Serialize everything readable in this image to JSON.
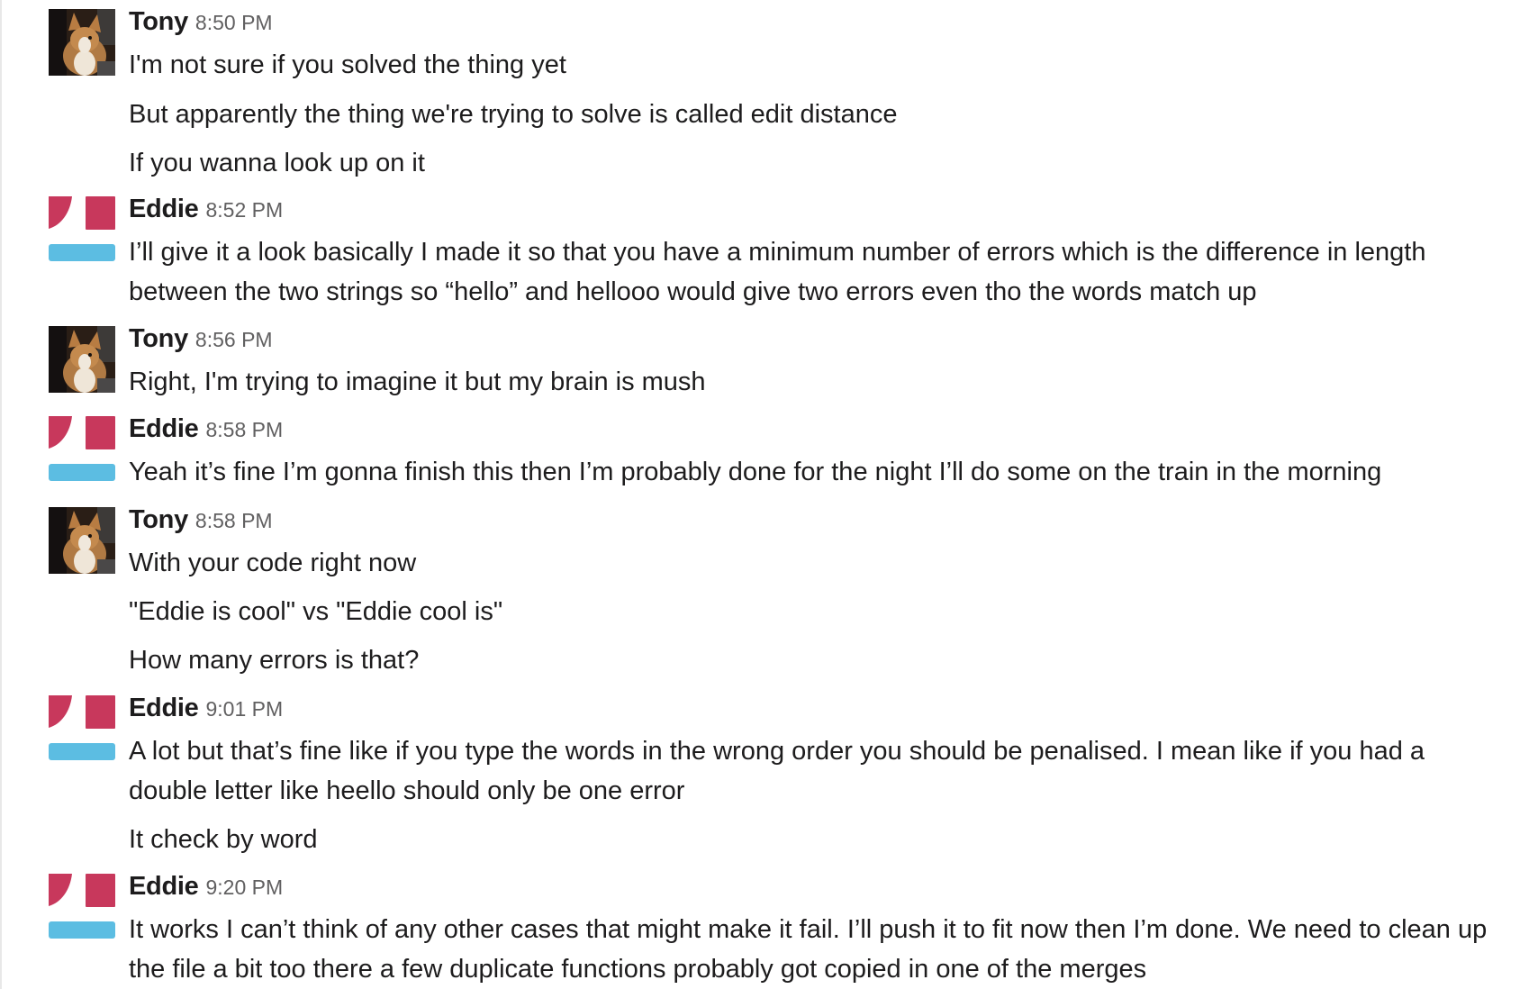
{
  "messages": [
    {
      "sender": "Tony",
      "time": "8:50 PM",
      "avatar_icon": "corgi-photo",
      "lines": [
        "I'm not sure if you solved the thing yet",
        "But apparently the thing we're trying to solve is called edit distance",
        "If you wanna look up on it"
      ]
    },
    {
      "sender": "Eddie",
      "time": "8:52 PM",
      "avatar_icon": "geometric-identicon",
      "lines": [
        "I’ll give it a look basically I made it so that you have a minimum number of errors which is the difference in length between the two strings so “hello” and hellooo would give two errors even tho the words match up"
      ]
    },
    {
      "sender": "Tony",
      "time": "8:56 PM",
      "avatar_icon": "corgi-photo",
      "lines": [
        "Right, I'm trying to imagine it but my brain is mush"
      ]
    },
    {
      "sender": "Eddie",
      "time": "8:58 PM",
      "avatar_icon": "geometric-identicon",
      "lines": [
        "Yeah it’s fine I’m gonna finish this then I’m probably done for the night I’ll do some on the train in the morning"
      ]
    },
    {
      "sender": "Tony",
      "time": "8:58 PM",
      "avatar_icon": "corgi-photo",
      "lines": [
        "With your code right now",
        "\"Eddie is cool\" vs \"Eddie cool is\"",
        "How many errors is that?"
      ]
    },
    {
      "sender": "Eddie",
      "time": "9:01 PM",
      "avatar_icon": "geometric-identicon",
      "lines": [
        "A lot but that’s fine like if you type the words in the wrong order you should be penalised. I mean like if you had a double letter like heello should only be one error",
        "It check by word"
      ]
    },
    {
      "sender": "Eddie",
      "time": "9:20 PM",
      "avatar_icon": "geometric-identicon",
      "lines": [
        "It works I can’t think of any other cases that might make it fail. I’ll push it to fit now then I’m done. We need to clean up the file a bit too there a few duplicate functions probably got copied in one of the merges"
      ]
    }
  ],
  "colors": {
    "identicon_red": "#c8385c",
    "identicon_blue": "#5cbde2",
    "timestamp": "#616061",
    "text": "#1d1c1d"
  }
}
